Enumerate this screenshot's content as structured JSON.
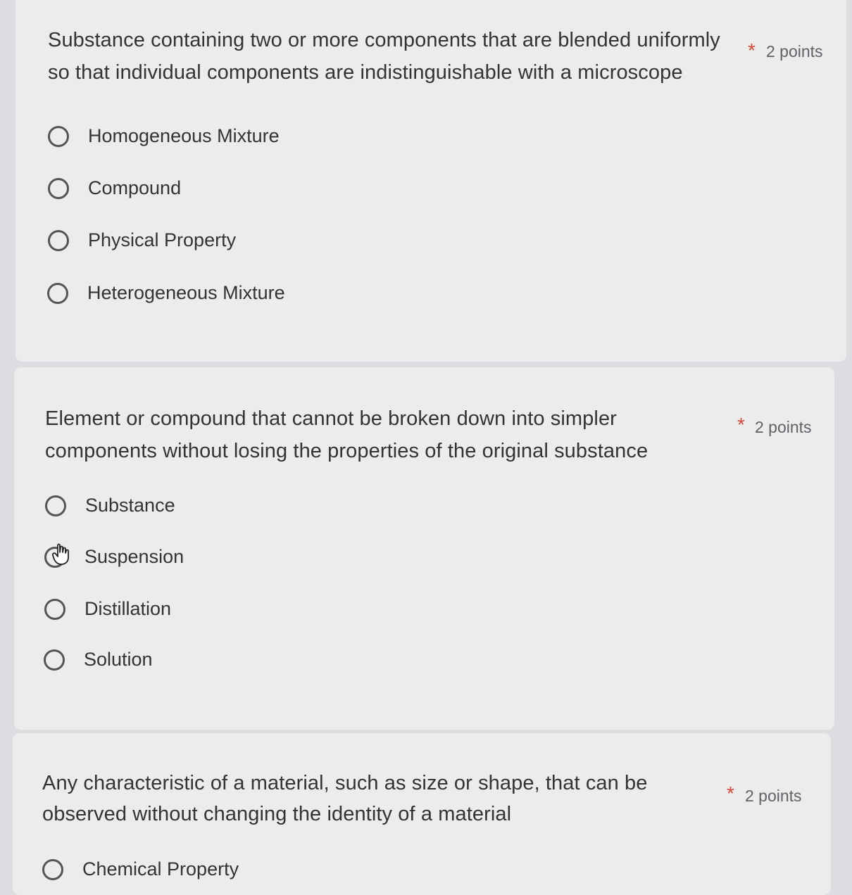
{
  "questions": [
    {
      "line1": "Substance containing two or more components that are blended uniformly",
      "line2": "so that individual components are indistinguishable with a microscope",
      "required": "*",
      "points": "2 points",
      "options": [
        "Homogeneous Mixture",
        "Compound",
        "Physical Property",
        "Heterogeneous Mixture"
      ]
    },
    {
      "line1": "Element or compound that cannot be broken down into simpler",
      "line2": "components without losing the properties of the original substance",
      "required": "*",
      "points": "2 points",
      "options": [
        "Substance",
        "Suspension",
        "Distillation",
        "Solution"
      ]
    },
    {
      "line1": "Any characteristic of a material, such as size or shape, that can be",
      "line2": "observed without changing the identity of a material",
      "required": "*",
      "points": "2 points",
      "options": [
        "Chemical Property"
      ]
    }
  ],
  "cursor": {
    "icon": "hand-pointer-icon",
    "over_option": "Suspension"
  },
  "colors": {
    "background": "#dcdde0",
    "card": "#ececec",
    "required": "#d44a3a",
    "text": "#333333"
  }
}
